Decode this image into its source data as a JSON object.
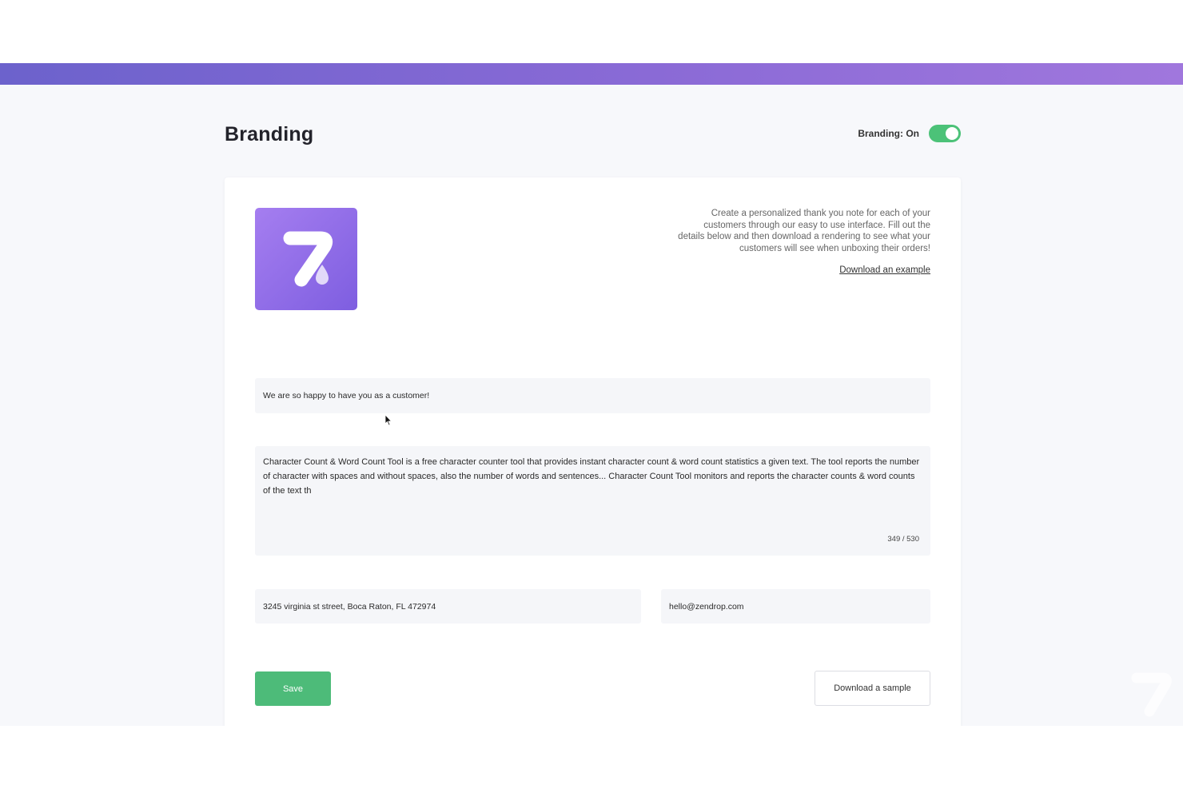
{
  "header": {
    "title": "Branding",
    "toggle_label": "Branding: On",
    "toggle_on": true,
    "toggle_color": "#4cc278",
    "accent_gradient": [
      "#6c62cc",
      "#a077dd"
    ]
  },
  "card": {
    "logo": {
      "icon": "zendrop-logo-icon",
      "colors": [
        "#a57ef0",
        "#7e5ee0"
      ]
    },
    "description": "Create a personalized thank you note for each of your customers through our easy to use interface. Fill out the details below and then download a rendering to see what your customers will see when unboxing their orders!",
    "download_example_label": "Download an example",
    "greeting_value": "We are so happy to have you as a customer!",
    "message_value": "Character Count & Word Count Tool is a free character counter tool that provides instant character count & word count statistics a given text. The tool reports the number of character with spaces and without spaces, also the number of words and sentences... Character Count Tool monitors and reports the character counts & word counts of the text th",
    "char_count": "349 / 530",
    "address_value": "3245 virginia st street, Boca Raton, FL 472974",
    "email_value": "hello@zendrop.com",
    "save_label": "Save",
    "save_color": "#4dbb79",
    "download_sample_label": "Download a sample"
  }
}
